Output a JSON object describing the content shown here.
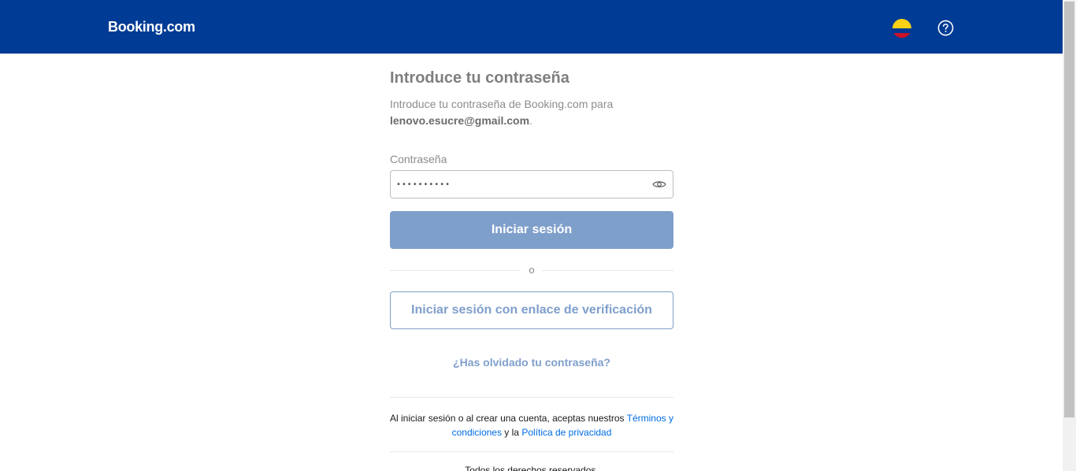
{
  "header": {
    "logo": "Booking.com",
    "flag_icon": "colombia-flag-icon",
    "help_icon": "question-circle-icon",
    "bg_color": "#003b95"
  },
  "main": {
    "title": "Introduce tu contraseña",
    "intro_text": "Introduce tu contraseña de Booking.com para",
    "email": "lenovo.esucre@gmail.com",
    "intro_end": ".",
    "password_label": "Contraseña",
    "password_value": "••••••••••",
    "show_password_icon": "eye-icon",
    "signin_button": "Iniciar sesión",
    "divider_text": "o",
    "verification_button": "Iniciar sesión con enlace de verificación",
    "forgot_link": "¿Has olvidado tu contraseña?",
    "accent_color": "#7f9fcb"
  },
  "footer": {
    "terms_prefix": "Al iniciar sesión o al crear una cuenta, aceptas nuestros ",
    "terms_link": "Términos y condiciones",
    "terms_middle": " y la ",
    "privacy_link": "Política de privacidad",
    "rights_text": "Todos los derechos reservados."
  }
}
